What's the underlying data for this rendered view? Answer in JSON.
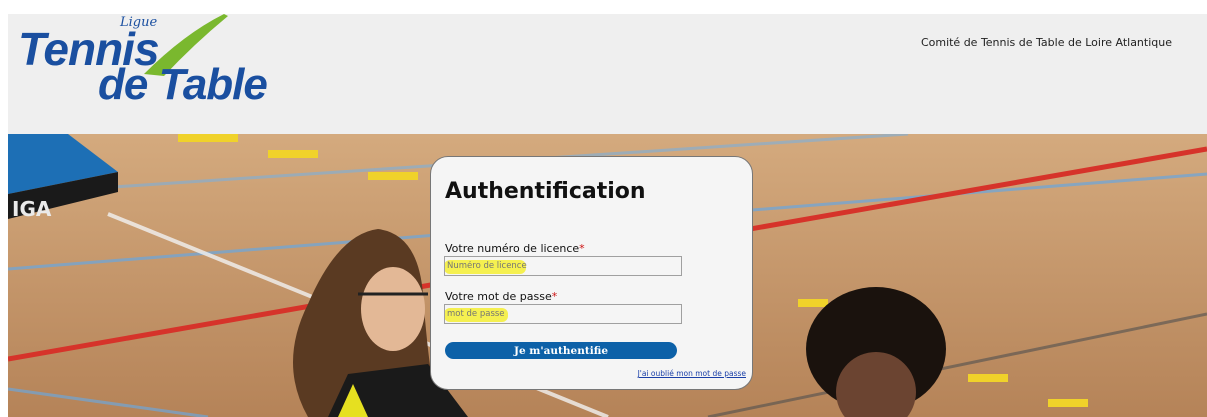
{
  "header": {
    "logo_line1": "Tennis",
    "logo_line2": "de Table",
    "logo_script": "Ligue",
    "site_title": "Comité de Tennis de Table de Loire Atlantique"
  },
  "hero": {
    "table_brand": "IGA"
  },
  "login": {
    "title": "Authentification",
    "licence_label": "Votre numéro de licence",
    "licence_placeholder": "Numéro de licence",
    "password_label": "Votre mot de passe",
    "password_placeholder": "mot de passe",
    "required_mark": "*",
    "submit_label": "Je m'authentifie",
    "forgot_link": "J'ai oublié mon mot de passe"
  },
  "colors": {
    "brand_blue": "#1a4fa0",
    "button_blue": "#0d61a8",
    "highlight": "#f4ee33",
    "required_red": "#cc1111"
  }
}
